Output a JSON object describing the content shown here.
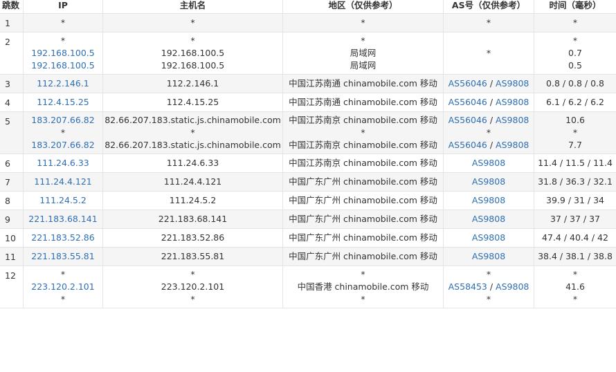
{
  "headers": [
    "跳数",
    "IP",
    "主机名",
    "地区（仅供参考）",
    "AS号（仅供参考）",
    "时间（毫秒）"
  ],
  "colors": {
    "link": "#2f6fb3",
    "row_alt": "#f5f5f5",
    "border": "#e4e4e4"
  },
  "rows": [
    {
      "hop": "1",
      "ip": [
        "*"
      ],
      "host": [
        "*"
      ],
      "region": [
        "*"
      ],
      "as": [
        [
          "*"
        ]
      ],
      "time": [
        "*"
      ]
    },
    {
      "hop": "2",
      "ip": [
        "*",
        "192.168.100.5",
        "192.168.100.5"
      ],
      "host": [
        "*",
        "192.168.100.5",
        "192.168.100.5"
      ],
      "region": [
        "*",
        "局域网",
        "局域网"
      ],
      "as": [
        [
          "*"
        ]
      ],
      "time": [
        "*",
        "0.7",
        "0.5"
      ]
    },
    {
      "hop": "3",
      "ip": [
        "112.2.146.1"
      ],
      "host": [
        "112.2.146.1"
      ],
      "region": [
        "中国江苏南通 chinamobile.com 移动"
      ],
      "as": [
        [
          "AS56046",
          "AS9808"
        ]
      ],
      "time": [
        "0.8 / 0.8 / 0.8"
      ]
    },
    {
      "hop": "4",
      "ip": [
        "112.4.15.25"
      ],
      "host": [
        "112.4.15.25"
      ],
      "region": [
        "中国江苏南通 chinamobile.com 移动"
      ],
      "as": [
        [
          "AS56046",
          "AS9808"
        ]
      ],
      "time": [
        "6.1 / 6.2 / 6.2"
      ]
    },
    {
      "hop": "5",
      "ip": [
        "183.207.66.82",
        "*",
        "183.207.66.82"
      ],
      "host": [
        "82.66.207.183.static.js.chinamobile.com",
        "*",
        "82.66.207.183.static.js.chinamobile.com"
      ],
      "region": [
        "中国江苏南京 chinamobile.com 移动",
        "*",
        "中国江苏南京 chinamobile.com 移动"
      ],
      "as": [
        [
          "AS56046",
          "AS9808"
        ],
        [
          "*"
        ],
        [
          "AS56046",
          "AS9808"
        ]
      ],
      "time": [
        "10.6",
        "*",
        "7.7"
      ]
    },
    {
      "hop": "6",
      "ip": [
        "111.24.6.33"
      ],
      "host": [
        "111.24.6.33"
      ],
      "region": [
        "中国江苏南京 chinamobile.com 移动"
      ],
      "as": [
        [
          "AS9808"
        ]
      ],
      "time": [
        "11.4 / 11.5 / 11.4"
      ]
    },
    {
      "hop": "7",
      "ip": [
        "111.24.4.121"
      ],
      "host": [
        "111.24.4.121"
      ],
      "region": [
        "中国广东广州 chinamobile.com 移动"
      ],
      "as": [
        [
          "AS9808"
        ]
      ],
      "time": [
        "31.8 / 36.3 / 32.1"
      ]
    },
    {
      "hop": "8",
      "ip": [
        "111.24.5.2"
      ],
      "host": [
        "111.24.5.2"
      ],
      "region": [
        "中国广东广州 chinamobile.com 移动"
      ],
      "as": [
        [
          "AS9808"
        ]
      ],
      "time": [
        "39.9 / 31 / 34"
      ]
    },
    {
      "hop": "9",
      "ip": [
        "221.183.68.141"
      ],
      "host": [
        "221.183.68.141"
      ],
      "region": [
        "中国广东广州 chinamobile.com 移动"
      ],
      "as": [
        [
          "AS9808"
        ]
      ],
      "time": [
        "37 / 37 / 37"
      ]
    },
    {
      "hop": "10",
      "ip": [
        "221.183.52.86"
      ],
      "host": [
        "221.183.52.86"
      ],
      "region": [
        "中国广东广州 chinamobile.com 移动"
      ],
      "as": [
        [
          "AS9808"
        ]
      ],
      "time": [
        "47.4 / 40.4 / 42"
      ]
    },
    {
      "hop": "11",
      "ip": [
        "221.183.55.81"
      ],
      "host": [
        "221.183.55.81"
      ],
      "region": [
        "中国广东广州 chinamobile.com 移动"
      ],
      "as": [
        [
          "AS9808"
        ]
      ],
      "time": [
        "38.4 / 38.1 / 38.8"
      ]
    },
    {
      "hop": "12",
      "ip": [
        "*",
        "223.120.2.101",
        "*"
      ],
      "host": [
        "*",
        "223.120.2.101",
        "*"
      ],
      "region": [
        "*",
        "中国香港 chinamobile.com 移动",
        "*"
      ],
      "as": [
        [
          "*"
        ],
        [
          "AS58453",
          "AS9808"
        ],
        [
          "*"
        ]
      ],
      "time": [
        "*",
        "41.6",
        "*"
      ]
    }
  ]
}
